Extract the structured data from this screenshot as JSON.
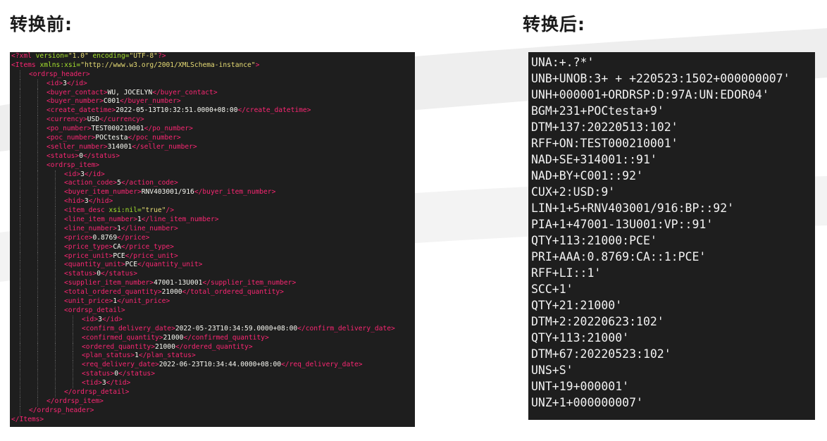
{
  "headings": {
    "before": "转换前:",
    "after": "转换后:"
  },
  "colors": {
    "panel_bg": "#1e1e1e",
    "tag": "#f92672",
    "attribute": "#a6e22e",
    "string": "#e6db74",
    "text": "#f8f8f2"
  },
  "xml_lines": [
    {
      "indent": 0,
      "parts": [
        [
          "pi",
          "<?xml "
        ],
        [
          "attr",
          "version="
        ],
        [
          "str",
          "\"1.0\" "
        ],
        [
          "attr",
          "encoding="
        ],
        [
          "str",
          "\"UTF-8\""
        ],
        [
          "pi",
          "?>"
        ]
      ]
    },
    {
      "indent": 0,
      "parts": [
        [
          "tag",
          "<Items "
        ],
        [
          "attr",
          "xmlns:xsi="
        ],
        [
          "str",
          "\"http://www.w3.org/2001/XMLSchema-instance\""
        ],
        [
          "tag",
          ">"
        ]
      ]
    },
    {
      "indent": 1,
      "parts": [
        [
          "tag",
          "<ordrsp_header>"
        ]
      ]
    },
    {
      "indent": 2,
      "parts": [
        [
          "tag",
          "<id>"
        ],
        [
          "txt",
          "3"
        ],
        [
          "tag",
          "</id>"
        ]
      ]
    },
    {
      "indent": 2,
      "parts": [
        [
          "tag",
          "<buyer_contact>"
        ],
        [
          "txt",
          "WU, JOCELYN"
        ],
        [
          "tag",
          "</buyer_contact>"
        ]
      ]
    },
    {
      "indent": 2,
      "parts": [
        [
          "tag",
          "<buyer_number>"
        ],
        [
          "txt",
          "C001"
        ],
        [
          "tag",
          "</buyer_number>"
        ]
      ]
    },
    {
      "indent": 2,
      "parts": [
        [
          "tag",
          "<create_datetime>"
        ],
        [
          "txt",
          "2022-05-13T10:32:51.0000+08:00"
        ],
        [
          "tag",
          "</create_datetime>"
        ]
      ]
    },
    {
      "indent": 2,
      "parts": [
        [
          "tag",
          "<currency>"
        ],
        [
          "txt",
          "USD"
        ],
        [
          "tag",
          "</currency>"
        ]
      ]
    },
    {
      "indent": 2,
      "parts": [
        [
          "tag",
          "<po_number>"
        ],
        [
          "txt",
          "TEST000210001"
        ],
        [
          "tag",
          "</po_number>"
        ]
      ]
    },
    {
      "indent": 2,
      "parts": [
        [
          "tag",
          "<poc_number>"
        ],
        [
          "txt",
          "POCtesta"
        ],
        [
          "tag",
          "</poc_number>"
        ]
      ]
    },
    {
      "indent": 2,
      "parts": [
        [
          "tag",
          "<seller_number>"
        ],
        [
          "txt",
          "314001"
        ],
        [
          "tag",
          "</seller_number>"
        ]
      ]
    },
    {
      "indent": 2,
      "parts": [
        [
          "tag",
          "<status>"
        ],
        [
          "txt",
          "0"
        ],
        [
          "tag",
          "</status>"
        ]
      ]
    },
    {
      "indent": 2,
      "parts": [
        [
          "tag",
          "<ordrsp_item>"
        ]
      ]
    },
    {
      "indent": 3,
      "parts": [
        [
          "tag",
          "<id>"
        ],
        [
          "txt",
          "3"
        ],
        [
          "tag",
          "</id>"
        ]
      ]
    },
    {
      "indent": 3,
      "parts": [
        [
          "tag",
          "<action_code>"
        ],
        [
          "txt",
          "5"
        ],
        [
          "tag",
          "</action_code>"
        ]
      ]
    },
    {
      "indent": 3,
      "parts": [
        [
          "tag",
          "<buyer_item_number>"
        ],
        [
          "txt",
          "RNV403001/916"
        ],
        [
          "tag",
          "</buyer_item_number>"
        ]
      ]
    },
    {
      "indent": 3,
      "parts": [
        [
          "tag",
          "<hid>"
        ],
        [
          "txt",
          "3"
        ],
        [
          "tag",
          "</hid>"
        ]
      ]
    },
    {
      "indent": 3,
      "parts": [
        [
          "tag",
          "<item_desc "
        ],
        [
          "attr",
          "xsi:nil="
        ],
        [
          "str",
          "\"true\""
        ],
        [
          "tag",
          "/>"
        ]
      ]
    },
    {
      "indent": 3,
      "parts": [
        [
          "tag",
          "<line_item_number>"
        ],
        [
          "txt",
          "1"
        ],
        [
          "tag",
          "</line_item_number>"
        ]
      ]
    },
    {
      "indent": 3,
      "parts": [
        [
          "tag",
          "<line_number>"
        ],
        [
          "txt",
          "1"
        ],
        [
          "tag",
          "</line_number>"
        ]
      ]
    },
    {
      "indent": 3,
      "parts": [
        [
          "tag",
          "<price>"
        ],
        [
          "txt",
          "0.8769"
        ],
        [
          "tag",
          "</price>"
        ]
      ]
    },
    {
      "indent": 3,
      "parts": [
        [
          "tag",
          "<price_type>"
        ],
        [
          "txt",
          "CA"
        ],
        [
          "tag",
          "</price_type>"
        ]
      ]
    },
    {
      "indent": 3,
      "parts": [
        [
          "tag",
          "<price_unit>"
        ],
        [
          "txt",
          "PCE"
        ],
        [
          "tag",
          "</price_unit>"
        ]
      ]
    },
    {
      "indent": 3,
      "parts": [
        [
          "tag",
          "<quantity_unit>"
        ],
        [
          "txt",
          "PCE"
        ],
        [
          "tag",
          "</quantity_unit>"
        ]
      ]
    },
    {
      "indent": 3,
      "parts": [
        [
          "tag",
          "<status>"
        ],
        [
          "txt",
          "0"
        ],
        [
          "tag",
          "</status>"
        ]
      ]
    },
    {
      "indent": 3,
      "parts": [
        [
          "tag",
          "<supplier_item_number>"
        ],
        [
          "txt",
          "47001-13U001"
        ],
        [
          "tag",
          "</supplier_item_number>"
        ]
      ]
    },
    {
      "indent": 3,
      "parts": [
        [
          "tag",
          "<total_ordered_quantity>"
        ],
        [
          "txt",
          "21000"
        ],
        [
          "tag",
          "</total_ordered_quantity>"
        ]
      ]
    },
    {
      "indent": 3,
      "parts": [
        [
          "tag",
          "<unit_price>"
        ],
        [
          "txt",
          "1"
        ],
        [
          "tag",
          "</unit_price>"
        ]
      ]
    },
    {
      "indent": 3,
      "parts": [
        [
          "tag",
          "<ordrsp_detail>"
        ]
      ]
    },
    {
      "indent": 4,
      "parts": [
        [
          "tag",
          "<id>"
        ],
        [
          "txt",
          "3"
        ],
        [
          "tag",
          "</id>"
        ]
      ]
    },
    {
      "indent": 4,
      "parts": [
        [
          "tag",
          "<confirm_delivery_date>"
        ],
        [
          "txt",
          "2022-05-23T10:34:59.0000+08:00"
        ],
        [
          "tag",
          "</confirm_delivery_date>"
        ]
      ]
    },
    {
      "indent": 4,
      "parts": [
        [
          "tag",
          "<confirmed_quantity>"
        ],
        [
          "txt",
          "21000"
        ],
        [
          "tag",
          "</confirmed_quantity>"
        ]
      ]
    },
    {
      "indent": 4,
      "parts": [
        [
          "tag",
          "<ordered_quantity>"
        ],
        [
          "txt",
          "21000"
        ],
        [
          "tag",
          "</ordered_quantity>"
        ]
      ]
    },
    {
      "indent": 4,
      "parts": [
        [
          "tag",
          "<plan_status>"
        ],
        [
          "txt",
          "1"
        ],
        [
          "tag",
          "</plan_status>"
        ]
      ]
    },
    {
      "indent": 4,
      "parts": [
        [
          "tag",
          "<req_delivery_date>"
        ],
        [
          "txt",
          "2022-06-23T10:34:44.0000+08:00"
        ],
        [
          "tag",
          "</req_delivery_date>"
        ]
      ]
    },
    {
      "indent": 4,
      "parts": [
        [
          "tag",
          "<status>"
        ],
        [
          "txt",
          "0"
        ],
        [
          "tag",
          "</status>"
        ]
      ]
    },
    {
      "indent": 4,
      "parts": [
        [
          "tag",
          "<tid>"
        ],
        [
          "txt",
          "3"
        ],
        [
          "tag",
          "</tid>"
        ]
      ]
    },
    {
      "indent": 3,
      "parts": [
        [
          "tag",
          "</ordrsp_detail>"
        ]
      ]
    },
    {
      "indent": 2,
      "parts": [
        [
          "tag",
          "</ordrsp_item>"
        ]
      ]
    },
    {
      "indent": 1,
      "parts": [
        [
          "tag",
          "</ordrsp_header>"
        ]
      ]
    },
    {
      "indent": 0,
      "parts": [
        [
          "tag",
          "</Items>"
        ]
      ]
    }
  ],
  "edi_lines": [
    "UNA:+.?*'",
    "UNB+UNOB:3+ + +220523:1502+000000007'",
    "UNH+000001+ORDRSP:D:97A:UN:EDOR04'",
    "BGM+231+POCtesta+9'",
    "DTM+137:20220513:102'",
    "RFF+ON:TEST000210001'",
    "NAD+SE+314001::91'",
    "NAD+BY+C001::92'",
    "CUX+2:USD:9'",
    "LIN+1+5+RNV403001/916:BP::92'",
    "PIA+1+47001-13U001:VP::91'",
    "QTY+113:21000:PCE'",
    "PRI+AAA:0.8769:CA::1:PCE'",
    "RFF+LI::1'",
    "SCC+1'",
    "QTY+21:21000'",
    "DTM+2:20220623:102'",
    "QTY+113:21000'",
    "DTM+67:20220523:102'",
    "UNS+S'",
    "UNT+19+000001'",
    "UNZ+1+000000007'"
  ]
}
